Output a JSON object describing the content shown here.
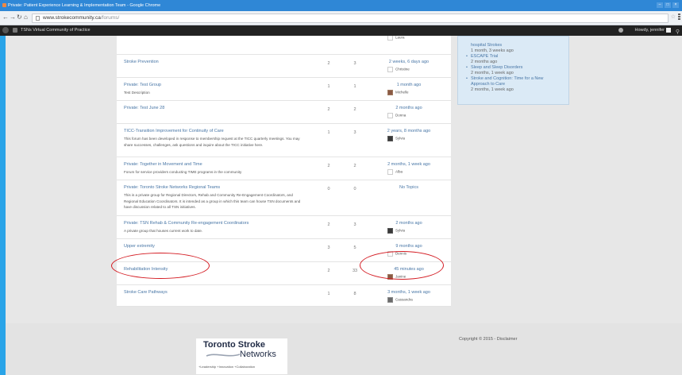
{
  "browser": {
    "window_title": "Private: Patient Experience Learning & Implementation Team - Google Chrome",
    "url_prefix": "www.strokecommunity.ca",
    "url_path": "/forums/"
  },
  "adminbar": {
    "site_name": "TSNs Virtual Community of Practice",
    "user_greeting": "Howdy, jennifer"
  },
  "forums": [
    {
      "name": "",
      "description": "",
      "topics": "",
      "posts": "",
      "freshness": "",
      "author": "Laura",
      "avatar": "blank"
    },
    {
      "name": "Stroke Prevention",
      "description": "",
      "topics": "2",
      "posts": "3",
      "freshness": "2 weeks, 6 days ago",
      "author": "Christine",
      "avatar": "blank"
    },
    {
      "name": "Private: Test Group",
      "description": "Test Description",
      "topics": "1",
      "posts": "1",
      "freshness": "1 month ago",
      "author": "Michelle",
      "avatar": "warm"
    },
    {
      "name": "Private: Test June 28",
      "description": "",
      "topics": "2",
      "posts": "2",
      "freshness": "2 months ago",
      "author": "Donna",
      "avatar": "blank"
    },
    {
      "name": "TICC-Transition Improvement for Continuity of Care",
      "description": "This forum has been developed in response to membership request at the TICC quarterly meetings. You may share successes, challenges, ask questions and inquire about the TICC initiative here.",
      "topics": "1",
      "posts": "3",
      "freshness": "2 years, 8 months ago",
      "author": "Sylvia",
      "avatar": "dark"
    },
    {
      "name": "Private: Together in Movement and Time",
      "description": "Forum for service providers conducting TIME programs in the community",
      "topics": "2",
      "posts": "2",
      "freshness": "2 months, 1 week ago",
      "author": "Alba",
      "avatar": "blank"
    },
    {
      "name": "Private: Toronto Stroke Networks Regional Teams",
      "description": "This is a private group for Regional Directors, Rehab and Community Re-Engagement Coordinators, and Regional Education Coordinators. It is intended as a group in which this team can house TSN documents and have discussion related to all TSN initiatives.",
      "topics": "0",
      "posts": "0",
      "freshness": "No Topics",
      "author": "",
      "avatar": ""
    },
    {
      "name": "Private: TSN Rehab & Community Re-engagement Coordinators",
      "description": "A private group that houses current work to date.",
      "topics": "2",
      "posts": "3",
      "freshness": "2 months ago",
      "author": "Sylvia",
      "avatar": "dark"
    },
    {
      "name": "Upper extremity",
      "description": "",
      "topics": "3",
      "posts": "5",
      "freshness": "9 months ago",
      "author": "Dennis",
      "avatar": "blank"
    },
    {
      "name": "Rehabilitation Intensity",
      "description": "",
      "topics": "2",
      "posts": "33",
      "freshness": "45 minutes ago",
      "author": "Janine",
      "avatar": "warm"
    },
    {
      "name": "Stroke Care Pathways",
      "description": "",
      "topics": "1",
      "posts": "8",
      "freshness": "3 months, 1 week ago",
      "author": "Cassandra",
      "avatar": "mid"
    }
  ],
  "sidebar": {
    "top_partial": "hospital Strokes",
    "top_time": "1 month, 3 weeks ago",
    "items": [
      {
        "title": "ESCAPE Trial",
        "time": "2 months ago"
      },
      {
        "title": "Sleep and Sleep Disorders",
        "time": "2 months, 1 week ago"
      },
      {
        "title_line1": "Stroke and Cognition: Time for a New",
        "title_line2": "Approach to Care",
        "time": "2 months, 1 week ago"
      }
    ]
  },
  "footer": {
    "logo_line1": "Toronto Stroke",
    "logo_line2": "Networks",
    "tagline": "+Leadership  +Innovation  +Collaboration",
    "copyright": "Copyright © 2015 - Disclaimer"
  },
  "colors": {
    "link": "#4876a6",
    "annotation_red": "#d41c23",
    "sidebar_bg": "#dbeaf6"
  }
}
